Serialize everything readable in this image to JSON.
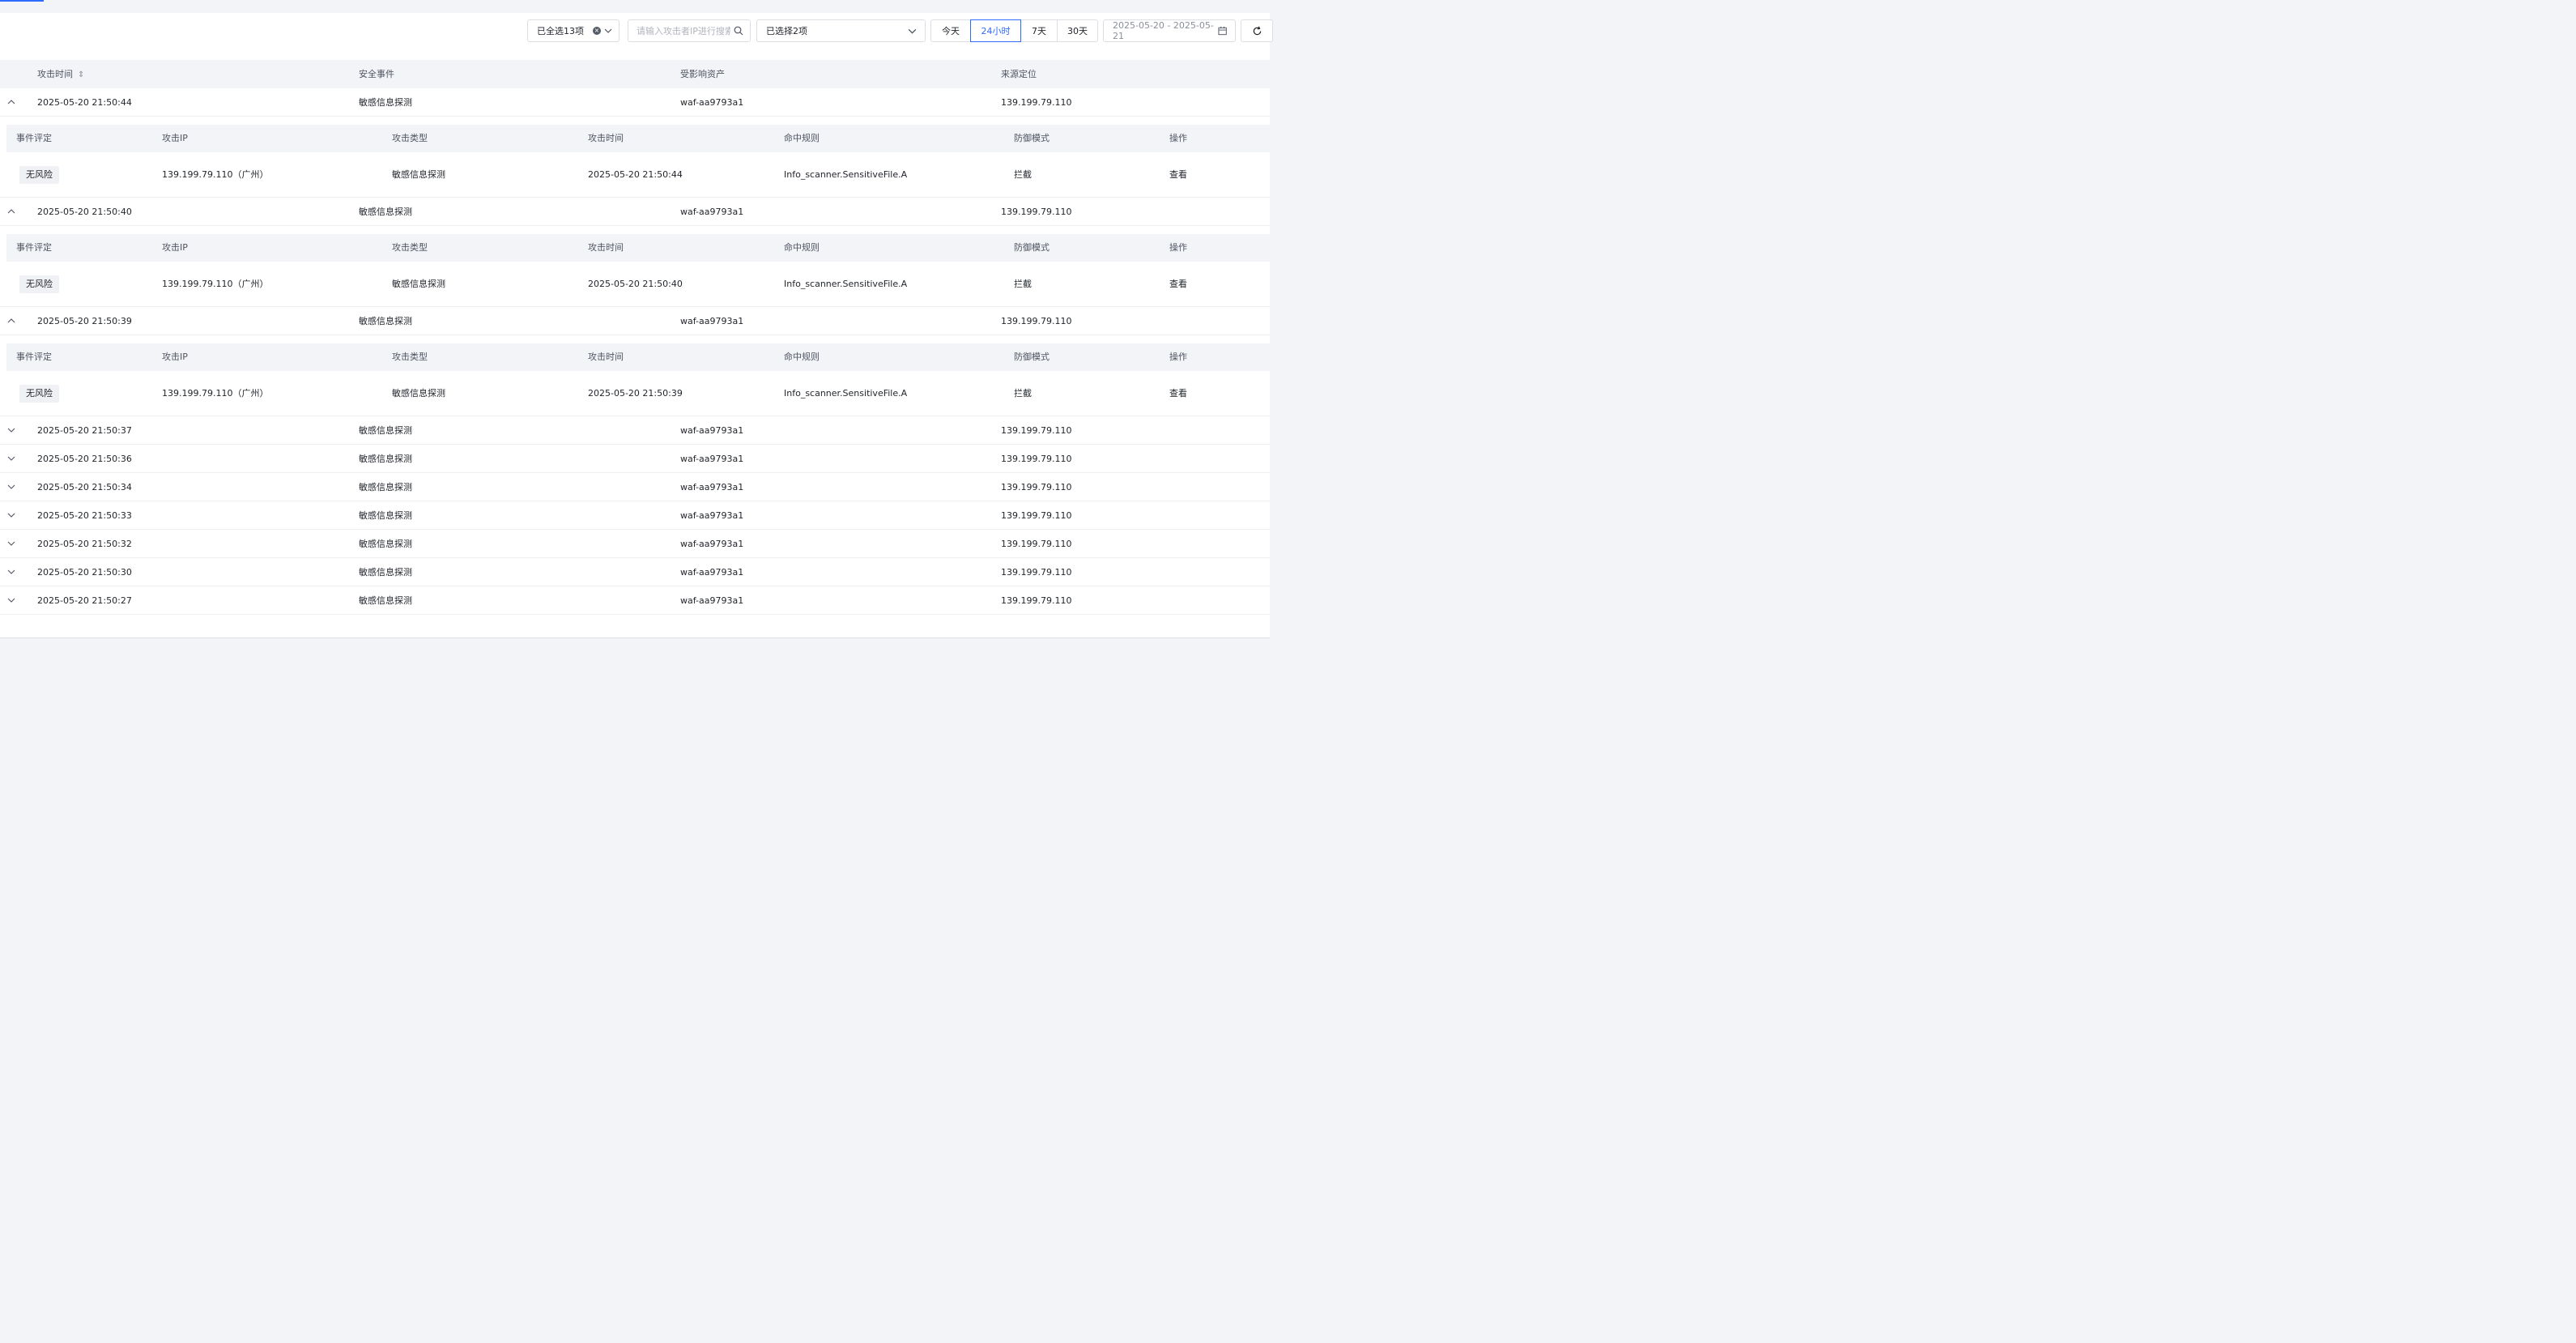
{
  "toolbar": {
    "select_all_label": "已全选13项",
    "search_placeholder": "请输入攻击者IP进行搜索",
    "multi_select_label": "已选择2项",
    "ranges": [
      "今天",
      "24小时",
      "7天",
      "30天"
    ],
    "active_range": "24小时",
    "date_range": "2025-05-20 - 2025-05-21"
  },
  "table": {
    "columns": [
      "攻击时间",
      "安全事件",
      "受影响资产",
      "来源定位"
    ],
    "detail_columns": [
      "事件评定",
      "攻击IP",
      "攻击类型",
      "攻击时间",
      "命中规则",
      "防御模式",
      "操作"
    ],
    "rows": [
      {
        "time": "2025-05-20 21:50:44",
        "event": "敏感信息探测",
        "asset": "waf-aa9793a1",
        "source": "139.199.79.110",
        "expanded": true,
        "detail": {
          "rating": "无风险",
          "ip": "139.199.79.110（广州）",
          "type": "敏感信息探测",
          "time": "2025-05-20 21:50:44",
          "rule": "Info_scanner.SensitiveFile.A",
          "mode": "拦截",
          "action": "查看"
        }
      },
      {
        "time": "2025-05-20 21:50:40",
        "event": "敏感信息探测",
        "asset": "waf-aa9793a1",
        "source": "139.199.79.110",
        "expanded": true,
        "detail": {
          "rating": "无风险",
          "ip": "139.199.79.110（广州）",
          "type": "敏感信息探测",
          "time": "2025-05-20 21:50:40",
          "rule": "Info_scanner.SensitiveFile.A",
          "mode": "拦截",
          "action": "查看"
        }
      },
      {
        "time": "2025-05-20 21:50:39",
        "event": "敏感信息探测",
        "asset": "waf-aa9793a1",
        "source": "139.199.79.110",
        "expanded": true,
        "detail": {
          "rating": "无风险",
          "ip": "139.199.79.110（广州）",
          "type": "敏感信息探测",
          "time": "2025-05-20 21:50:39",
          "rule": "Info_scanner.SensitiveFile.A",
          "mode": "拦截",
          "action": "查看"
        }
      },
      {
        "time": "2025-05-20 21:50:37",
        "event": "敏感信息探测",
        "asset": "waf-aa9793a1",
        "source": "139.199.79.110",
        "expanded": false
      },
      {
        "time": "2025-05-20 21:50:36",
        "event": "敏感信息探测",
        "asset": "waf-aa9793a1",
        "source": "139.199.79.110",
        "expanded": false
      },
      {
        "time": "2025-05-20 21:50:34",
        "event": "敏感信息探测",
        "asset": "waf-aa9793a1",
        "source": "139.199.79.110",
        "expanded": false
      },
      {
        "time": "2025-05-20 21:50:33",
        "event": "敏感信息探测",
        "asset": "waf-aa9793a1",
        "source": "139.199.79.110",
        "expanded": false
      },
      {
        "time": "2025-05-20 21:50:32",
        "event": "敏感信息探测",
        "asset": "waf-aa9793a1",
        "source": "139.199.79.110",
        "expanded": false
      },
      {
        "time": "2025-05-20 21:50:30",
        "event": "敏感信息探测",
        "asset": "waf-aa9793a1",
        "source": "139.199.79.110",
        "expanded": false
      },
      {
        "time": "2025-05-20 21:50:27",
        "event": "敏感信息探测",
        "asset": "waf-aa9793a1",
        "source": "139.199.79.110",
        "expanded": false
      }
    ]
  },
  "colors": {
    "accent": "#2f6bff",
    "header_bg": "#f3f4f7",
    "border": "#dcdee3"
  }
}
